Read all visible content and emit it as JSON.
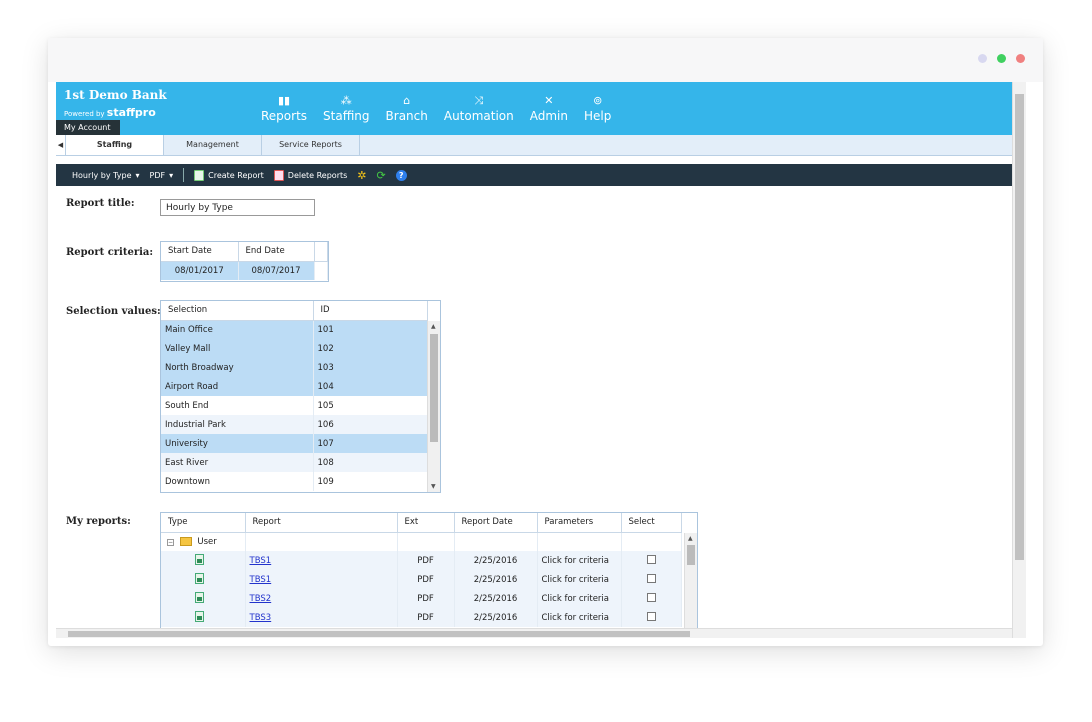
{
  "window": {
    "dots": [
      "#d8d8f0",
      "#40d060",
      "#f08080"
    ]
  },
  "header": {
    "brand": "1st Demo Bank",
    "powered_prefix": "Powered by ",
    "powered_brand": "staffpro",
    "my_account": "My Account",
    "nav": [
      {
        "label": "Reports",
        "icon": "bar-chart-icon",
        "glyph": "📊"
      },
      {
        "label": "Staffing",
        "icon": "org-chart-icon",
        "glyph": "⁂"
      },
      {
        "label": "Branch",
        "icon": "bank-icon",
        "glyph": "🏛"
      },
      {
        "label": "Automation",
        "icon": "shuffle-icon",
        "glyph": "⤨"
      },
      {
        "label": "Admin",
        "icon": "tools-icon",
        "glyph": "✕"
      },
      {
        "label": "Help",
        "icon": "help-icon",
        "glyph": "?"
      }
    ]
  },
  "tabs": {
    "items": [
      "Staffing",
      "Management",
      "Service Reports"
    ],
    "active": "Staffing"
  },
  "toolbar": {
    "type_select": "Hourly by Type",
    "format_select": "PDF",
    "create_report": "Create Report",
    "delete_reports": "Delete Reports"
  },
  "labels": {
    "report_title": "Report title:",
    "report_criteria": "Report criteria:",
    "selection_values": "Selection values:",
    "my_reports": "My reports:"
  },
  "report_title_value": "Hourly by Type",
  "criteria": {
    "headers": [
      "Start Date",
      "End Date"
    ],
    "start_date": "08/01/2017",
    "end_date": "08/07/2017"
  },
  "selection": {
    "headers": [
      "Selection",
      "ID"
    ],
    "rows": [
      {
        "name": "Main Office",
        "id": "101",
        "selected": true
      },
      {
        "name": "Valley Mall",
        "id": "102",
        "selected": true
      },
      {
        "name": "North Broadway",
        "id": "103",
        "selected": true
      },
      {
        "name": "Airport Road",
        "id": "104",
        "selected": true
      },
      {
        "name": "South End",
        "id": "105",
        "selected": false
      },
      {
        "name": "Industrial Park",
        "id": "106",
        "selected": false
      },
      {
        "name": "University",
        "id": "107",
        "selected": true
      },
      {
        "name": "East River",
        "id": "108",
        "selected": false
      },
      {
        "name": "Downtown",
        "id": "109",
        "selected": false
      }
    ]
  },
  "my_reports": {
    "headers": [
      "Type",
      "Report",
      "Ext",
      "Report Date",
      "Parameters",
      "Select"
    ],
    "folder": "User",
    "rows": [
      {
        "report": "TBS1",
        "ext": "PDF",
        "date": "2/25/2016",
        "params": "Click for criteria"
      },
      {
        "report": "TBS1",
        "ext": "PDF",
        "date": "2/25/2016",
        "params": "Click for criteria"
      },
      {
        "report": "TBS2",
        "ext": "PDF",
        "date": "2/25/2016",
        "params": "Click for criteria"
      },
      {
        "report": "TBS3",
        "ext": "PDF",
        "date": "2/25/2016",
        "params": "Click for criteria"
      }
    ]
  }
}
